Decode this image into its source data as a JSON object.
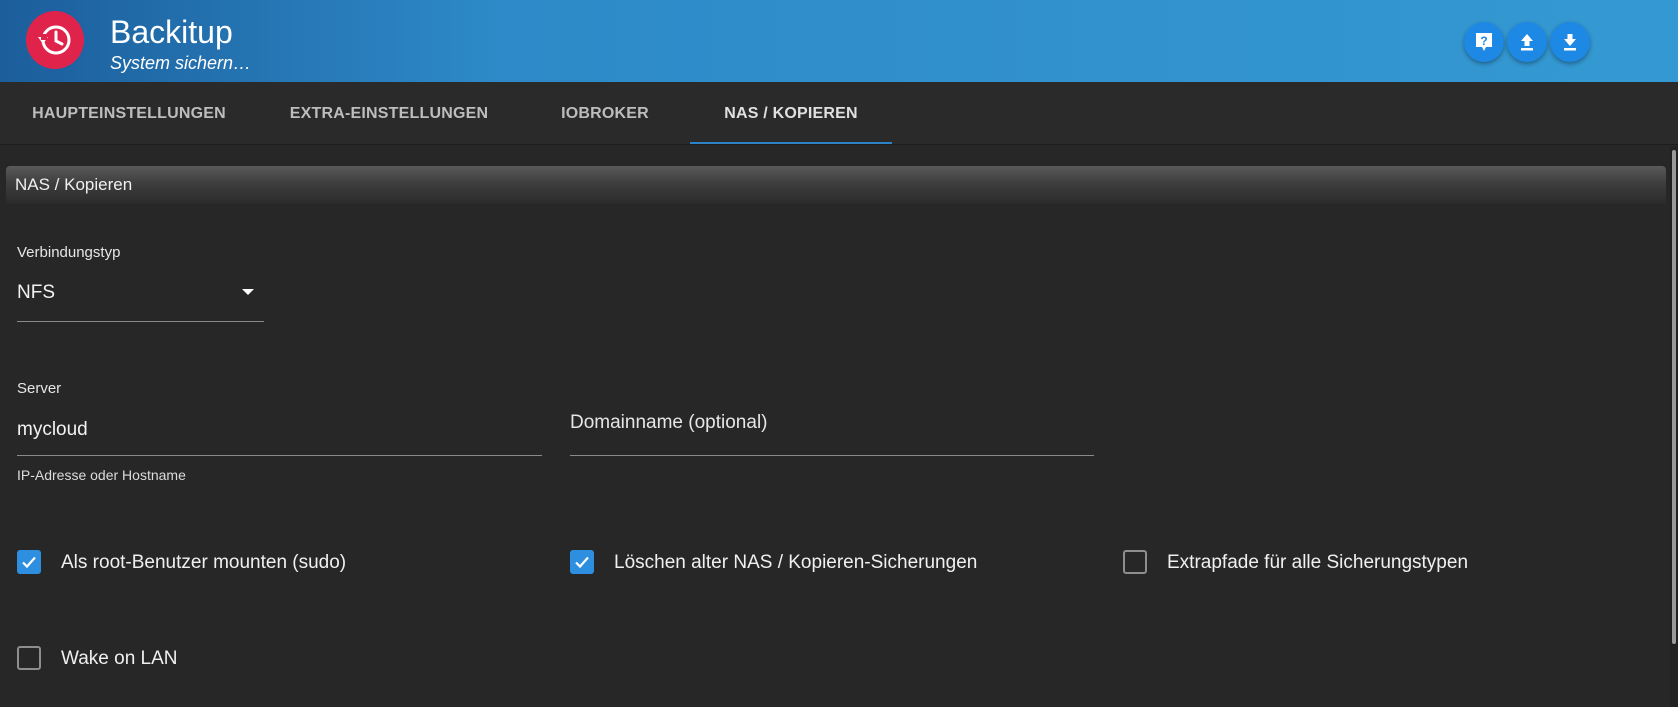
{
  "header": {
    "title": "Backitup",
    "subtitle": "System sichern…",
    "logo_icon": "backup-clock-icon",
    "buttons": [
      {
        "icon": "help-icon"
      },
      {
        "icon": "upload-icon"
      },
      {
        "icon": "download-icon"
      }
    ],
    "colors": {
      "accent": "#2e8ac8",
      "logo": "#e0234a",
      "button": "#1e88e5"
    }
  },
  "tabs": [
    {
      "label": "HAUPTEINSTELLUNGEN",
      "active": false
    },
    {
      "label": "EXTRA-EINSTELLUNGEN",
      "active": false
    },
    {
      "label": "IOBROKER",
      "active": false
    },
    {
      "label": "NAS / KOPIEREN",
      "active": true
    }
  ],
  "section": {
    "title": "NAS / Kopieren"
  },
  "form": {
    "connection_type": {
      "label": "Verbindungstyp",
      "value": "NFS"
    },
    "server": {
      "label": "Server",
      "value": "mycloud",
      "helper": "IP-Adresse oder Hostname"
    },
    "domain": {
      "placeholder": "Domainname (optional)",
      "value": ""
    },
    "checkboxes": [
      {
        "label": "Als root-Benutzer mounten (sudo)",
        "checked": true
      },
      {
        "label": "Löschen alter NAS / Kopieren-Sicherungen",
        "checked": true
      },
      {
        "label": "Extrapfade für alle Sicherungstypen",
        "checked": false
      },
      {
        "label": "Wake on LAN",
        "checked": false
      }
    ]
  }
}
